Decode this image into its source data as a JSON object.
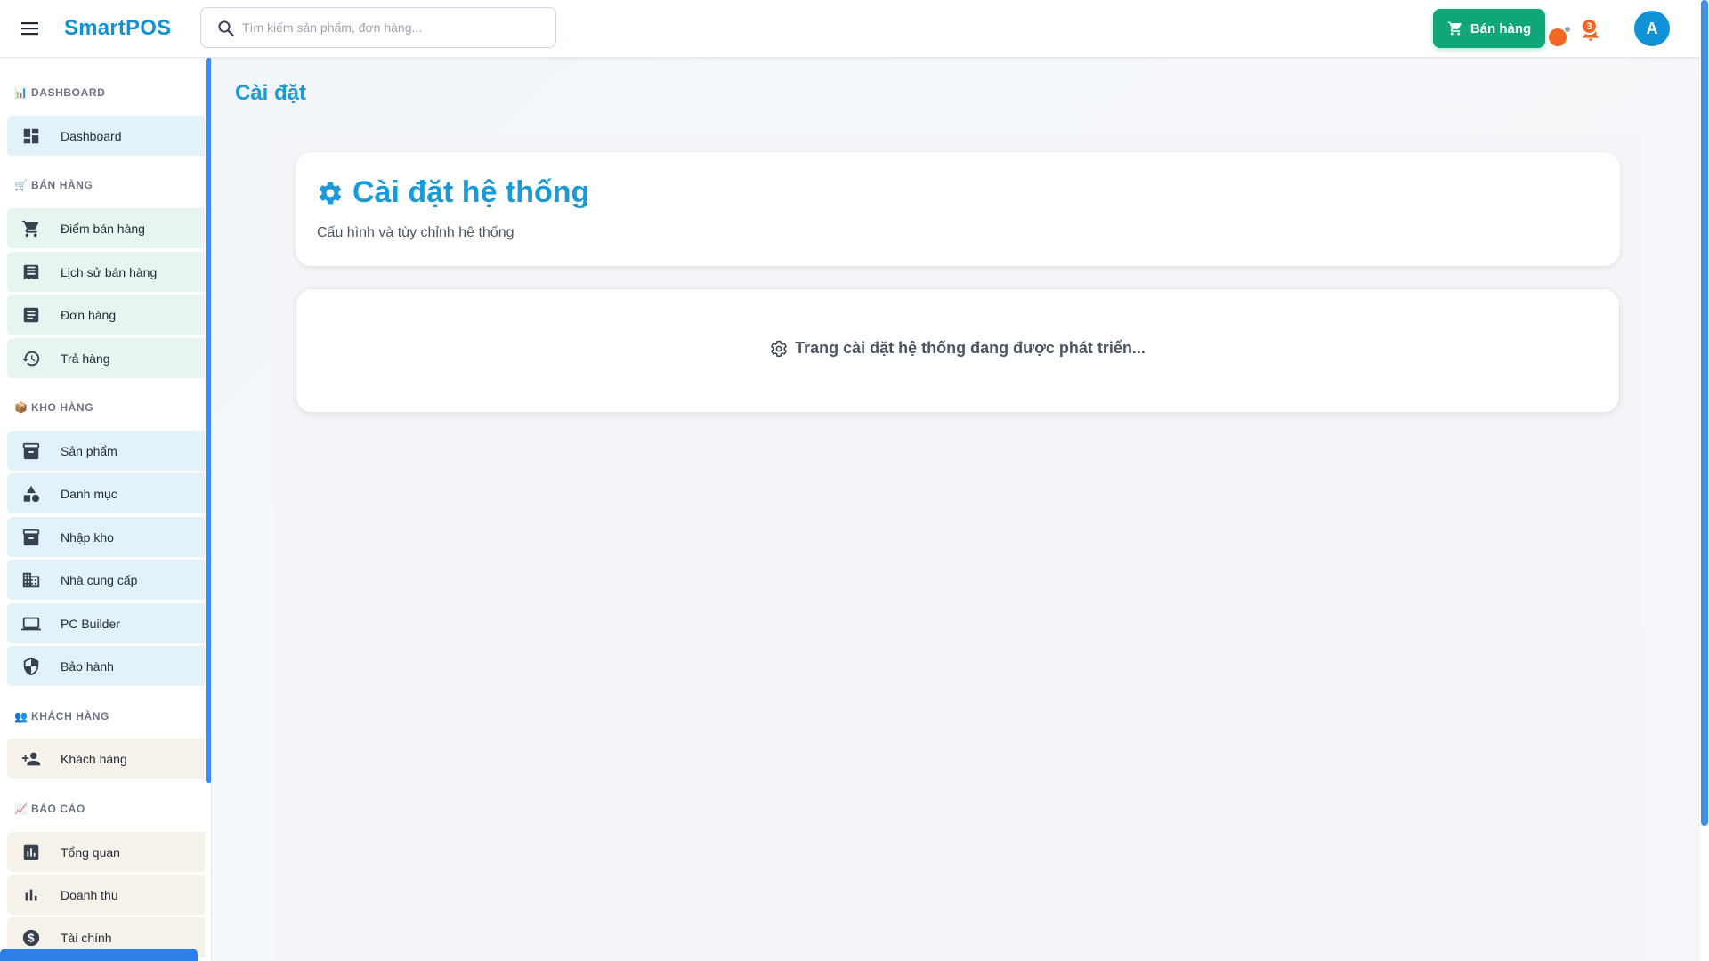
{
  "header": {
    "brand": "SmartPOS",
    "search_placeholder": "Tìm kiếm sản phẩm, đơn hàng...",
    "sell_button_label": "Bán hàng",
    "notification_count": "3",
    "avatar_initial": "A"
  },
  "sidebar": {
    "sections": [
      {
        "title": "DASHBOARD",
        "icon": "bar-chart-icon",
        "items": [
          {
            "label": "Dashboard",
            "icon": "dashboard-icon"
          }
        ]
      },
      {
        "title": "BÁN HÀNG",
        "icon": "shopping-cart-icon",
        "items": [
          {
            "label": "Điểm bán hàng",
            "icon": "cart-icon"
          },
          {
            "label": "Lịch sử bán hàng",
            "icon": "receipt-icon"
          },
          {
            "label": "Đơn hàng",
            "icon": "list-icon"
          },
          {
            "label": "Trả hàng",
            "icon": "history-icon"
          }
        ]
      },
      {
        "title": "KHO HÀNG",
        "icon": "package-icon",
        "items": [
          {
            "label": "Sản phẩm",
            "icon": "archive-icon"
          },
          {
            "label": "Danh mục",
            "icon": "category-icon"
          },
          {
            "label": "Nhập kho",
            "icon": "archive-icon"
          },
          {
            "label": "Nhà cung cấp",
            "icon": "building-icon"
          },
          {
            "label": "PC Builder",
            "icon": "laptop-icon"
          },
          {
            "label": "Bảo hành",
            "icon": "shield-icon"
          }
        ]
      },
      {
        "title": "KHÁCH HÀNG",
        "icon": "people-icon",
        "items": [
          {
            "label": "Khách hàng",
            "icon": "person-add-icon"
          }
        ]
      },
      {
        "title": "BÁO CÁO",
        "icon": "chart-up-icon",
        "items": [
          {
            "label": "Tổng quan",
            "icon": "assessment-icon"
          },
          {
            "label": "Doanh thu",
            "icon": "bar-chart-icon"
          },
          {
            "label": "Tài chính",
            "icon": "dollar-icon"
          }
        ]
      }
    ]
  },
  "main": {
    "page_title": "Cài đặt",
    "card_title": "Cài đặt hệ thống",
    "card_subtitle": "Cấu hình và tùy chỉnh hệ thống",
    "dev_message": "Trang cài đặt hệ thống đang được phát triển..."
  },
  "colors": {
    "brand": "#1192d6",
    "sell_button": "#0fa77a",
    "badge": "#f26722",
    "scrollbar": "#3b8eea"
  }
}
